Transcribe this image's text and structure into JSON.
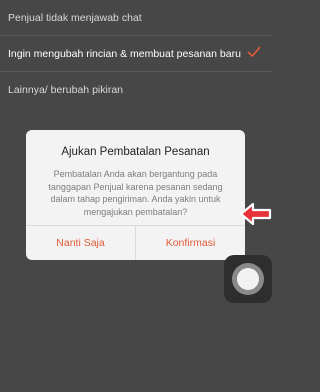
{
  "reasons": [
    {
      "label": "Penjual tidak menjawab chat"
    },
    {
      "label": "Ingin mengubah rincian & membuat pesanan baru"
    },
    {
      "label": "Lainnya/ berubah pikiran"
    }
  ],
  "dialog": {
    "title": "Ajukan Pembatalan Pesanan",
    "message": "Pembatalan Anda akan bergantung pada tanggapan Penjual karena pesanan sedang dalam tahap pengiriman. Anda yakin untuk mengajukan pembatalan?",
    "cancel_label": "Nanti Saja",
    "confirm_label": "Konfirmasi"
  },
  "colors": {
    "accent": "#e05a38",
    "annotation_arrow": "#e8323a"
  },
  "icons": {
    "selected": "checkmark-icon",
    "annotation": "arrow-left-icon",
    "assistive_touch": "assistive-touch-icon"
  }
}
